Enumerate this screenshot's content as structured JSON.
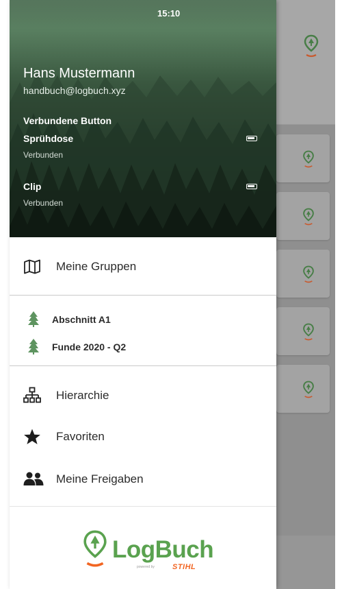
{
  "status_bar": {
    "time": "15:10"
  },
  "drawer": {
    "user": {
      "name": "Hans Mustermann",
      "email": "handbuch@logbuch.xyz"
    },
    "connected_buttons_title": "Verbundene Button",
    "devices": [
      {
        "name": "Sprühdose",
        "status": "Verbunden",
        "icon": "battery-icon"
      },
      {
        "name": "Clip",
        "status": "Verbunden",
        "icon": "battery-icon"
      }
    ],
    "menu_groups_label": "Meine Gruppen",
    "groups": [
      {
        "label": "Abschnitt A1",
        "icon": "tree-icon"
      },
      {
        "label": "Funde 2020 - Q2",
        "icon": "tree-icon"
      }
    ],
    "menu": [
      {
        "label": "Hierarchie",
        "icon": "hierarchy-icon"
      },
      {
        "label": "Favoriten",
        "icon": "star-icon"
      },
      {
        "label": "Meine Freigaben",
        "icon": "users-icon"
      }
    ],
    "logo": {
      "name": "LogBuch",
      "powered_by": "powered by",
      "brand": "STIHL"
    }
  },
  "colors": {
    "accent_green": "#5aa24f",
    "brand_orange": "#f26522",
    "tree_green": "#5e9460"
  }
}
